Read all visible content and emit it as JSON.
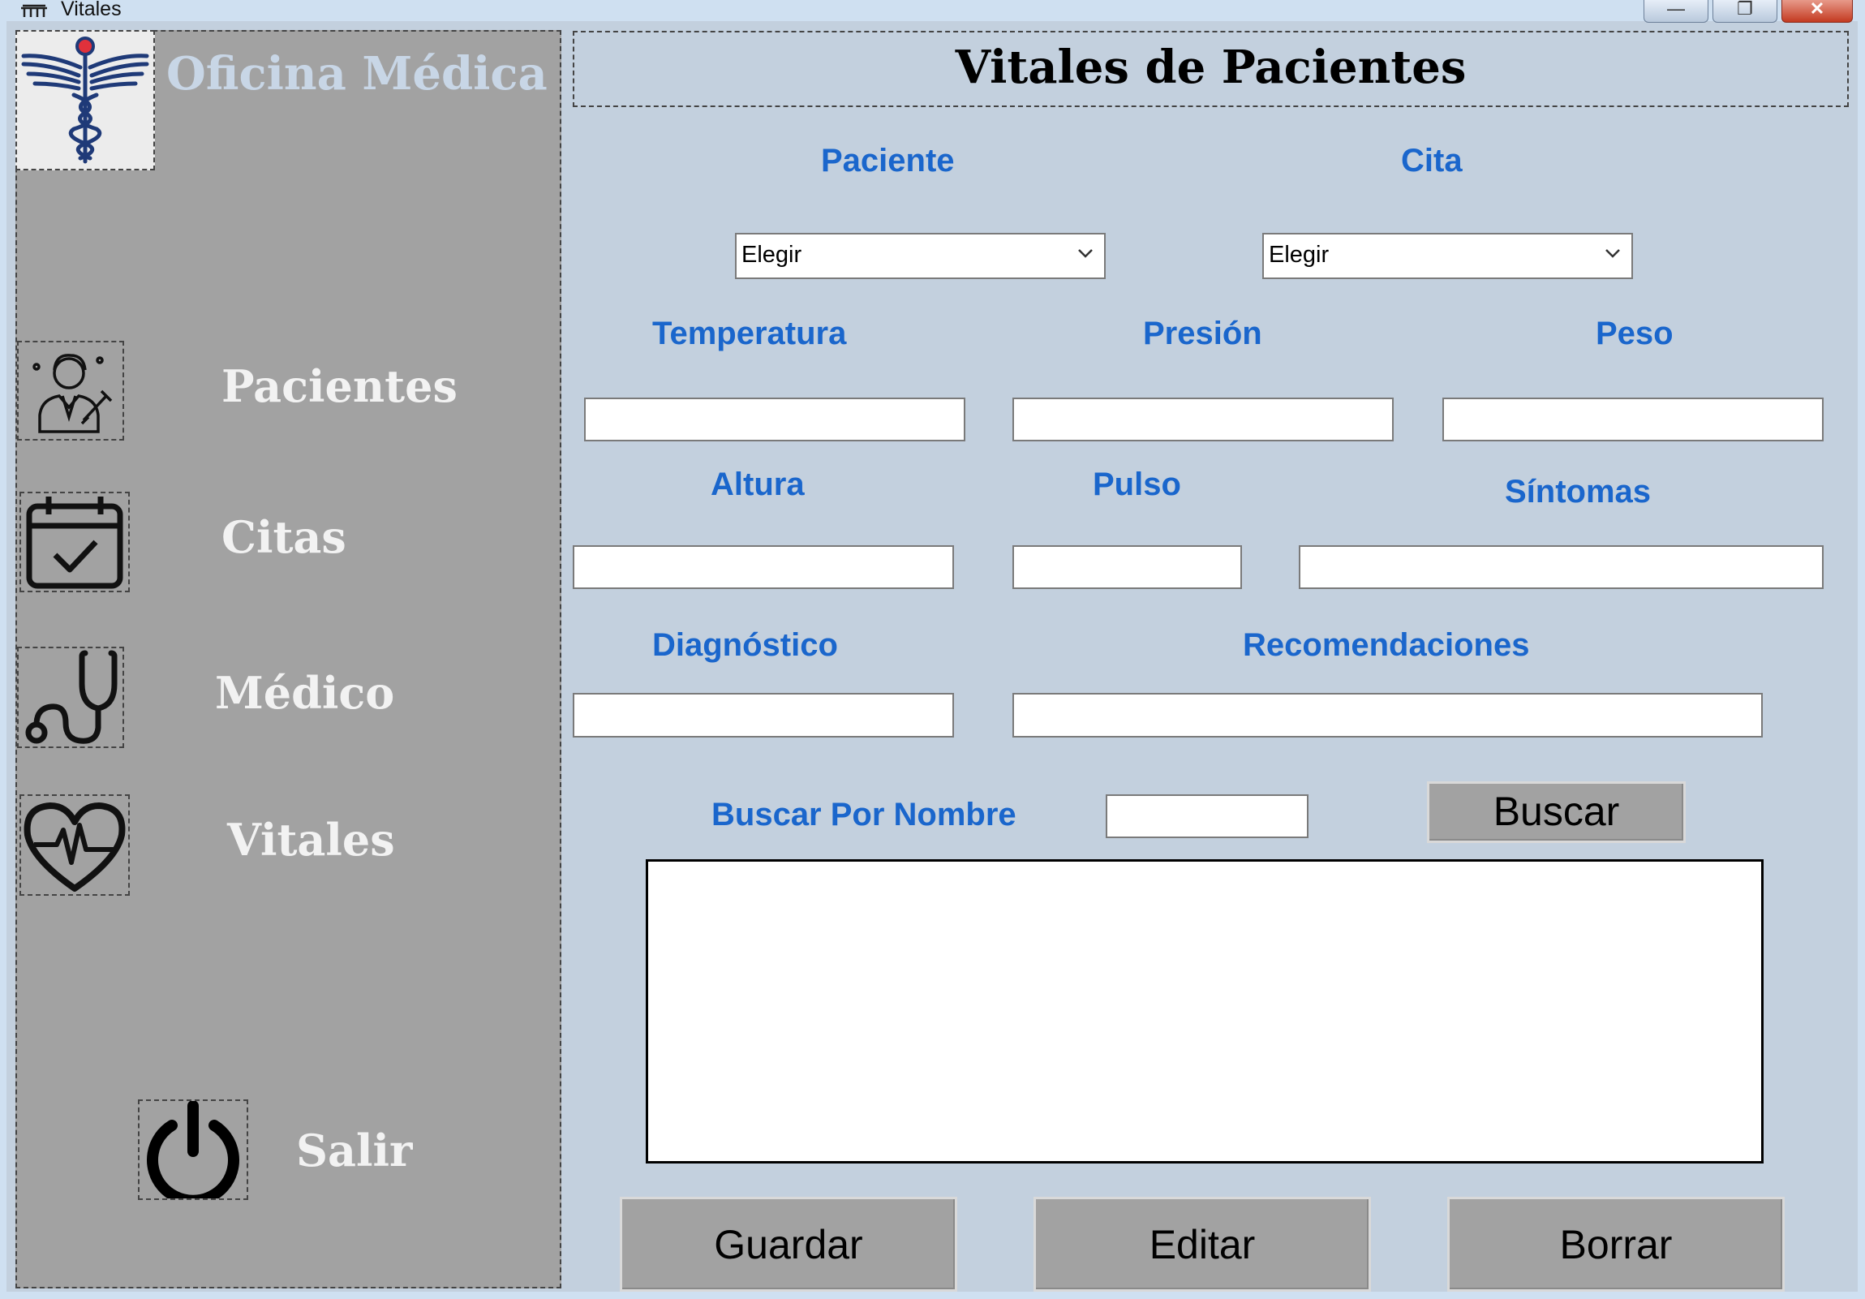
{
  "window": {
    "title": "Vitales",
    "minimize_glyph": "—",
    "maximize_glyph": "❐",
    "close_glyph": "✕"
  },
  "sidebar": {
    "brand": "Oficina Médica",
    "logo_icon": "caduceus-icon",
    "items": [
      {
        "label": "Pacientes",
        "icon": "doctor-icon"
      },
      {
        "label": "Citas",
        "icon": "calendar-check-icon"
      },
      {
        "label": "Médico",
        "icon": "stethoscope-icon"
      },
      {
        "label": "Vitales",
        "icon": "heartbeat-icon"
      }
    ],
    "exit": {
      "label": "Salir",
      "icon": "power-icon"
    }
  },
  "main": {
    "title": "Vitales de Pacientes",
    "fields": {
      "paciente": {
        "label": "Paciente",
        "value": "Elegir"
      },
      "cita": {
        "label": "Cita",
        "value": "Elegir"
      },
      "temperatura": {
        "label": "Temperatura",
        "value": ""
      },
      "presion": {
        "label": "Presión",
        "value": ""
      },
      "peso": {
        "label": "Peso",
        "value": ""
      },
      "altura": {
        "label": "Altura",
        "value": ""
      },
      "pulso": {
        "label": "Pulso",
        "value": ""
      },
      "sintomas": {
        "label": "Síntomas",
        "value": ""
      },
      "diagnostico": {
        "label": "Diagnóstico",
        "value": ""
      },
      "recomendaciones": {
        "label": "Recomendaciones",
        "value": ""
      }
    },
    "search": {
      "label": "Buscar Por Nombre",
      "value": "",
      "button": "Buscar"
    },
    "actions": {
      "save": "Guardar",
      "edit": "Editar",
      "delete": "Borrar"
    }
  },
  "colors": {
    "background": "#c3d0de",
    "sidebar": "#a2a2a2",
    "label_blue": "#1a66cc",
    "brand_text": "#c8d6e6"
  }
}
